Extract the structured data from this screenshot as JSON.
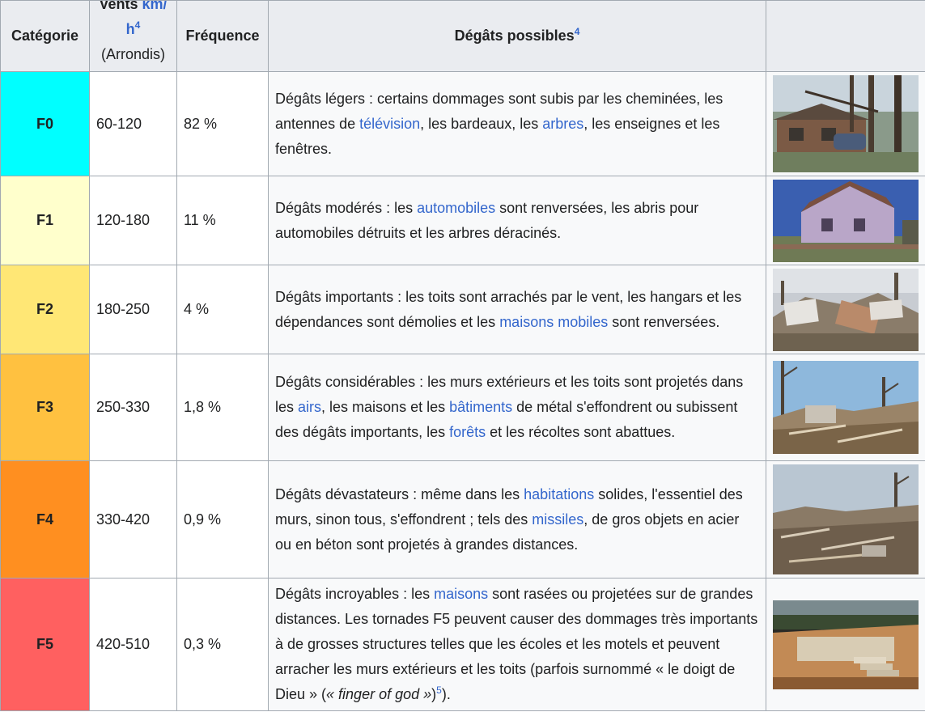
{
  "headers": {
    "category": "Catégorie",
    "winds": "Vents",
    "winds_unit_line1": "km/",
    "winds_unit_line2": "h",
    "winds_note": "4",
    "winds_rounded": "(Arrondis)",
    "frequency": "Fréquence",
    "damage": "Dégâts possibles",
    "damage_note": "4"
  },
  "colors": {
    "F0": "#00ffff",
    "F1": "#ffffcc",
    "F2": "#ffe775",
    "F3": "#ffc140",
    "F4": "#ff8f20",
    "F5": "#ff6060",
    "link": "#3366cc",
    "header_bg": "#eaecf0"
  },
  "rows": [
    {
      "category": "F0",
      "winds": "60-120",
      "frequency": "82 %",
      "d": {
        "t1": "Dégâts légers : certains dommages sont subis par les cheminées, les antennes de ",
        "l1": "télévision",
        "t2": ", les bardeaux, les ",
        "l2": "arbres",
        "t3": ", les enseignes et les fenêtres."
      }
    },
    {
      "category": "F1",
      "winds": "120-180",
      "frequency": "11 %",
      "d": {
        "t1": "Dégâts modérés : les ",
        "l1": "automobiles",
        "t2": " sont renversées, les abris pour automobiles détruits et les arbres déracinés."
      }
    },
    {
      "category": "F2",
      "winds": "180-250",
      "frequency": "4 %",
      "d": {
        "t1": "Dégâts importants : les toits sont arrachés par le vent, les hangars et les dépendances sont démolies et les ",
        "l1": "maisons mobiles",
        "t2": " sont renversées."
      }
    },
    {
      "category": "F3",
      "winds": "250-330",
      "frequency": "1,8 %",
      "d": {
        "t1": "Dégâts considérables : les murs extérieurs et les toits sont projetés dans les ",
        "l1": "airs",
        "t2": ", les maisons et les ",
        "l2": "bâtiments",
        "t3": " de métal s'effondrent ou subissent des dégâts importants, les ",
        "l3": "forêts",
        "t4": " et les récoltes sont abattues."
      }
    },
    {
      "category": "F4",
      "winds": "330-420",
      "frequency": "0,9 %",
      "d": {
        "t1": "Dégâts dévastateurs : même dans les ",
        "l1": "habitations",
        "t2": " solides, l'essentiel des murs, sinon tous, s'effondrent ; tels des ",
        "l2": "missiles",
        "t3": ", de gros objets en acier ou en béton sont projetés à grandes distances."
      }
    },
    {
      "category": "F5",
      "winds": "420-510",
      "frequency": "0,3 %",
      "d": {
        "t1": "Dégâts incroyables : les ",
        "l1": "maisons",
        "t2": " sont rasées ou projetées sur de grandes distances. Les tornades F5 peuvent causer des dommages très importants à de grosses structures telles que les écoles et les motels et peuvent arracher les murs extérieurs et les toits (parfois surnommé « le doigt de Dieu » (",
        "i1": "« finger of god »",
        "t3": ")",
        "s1": "5",
        "t4": ")."
      }
    }
  ]
}
